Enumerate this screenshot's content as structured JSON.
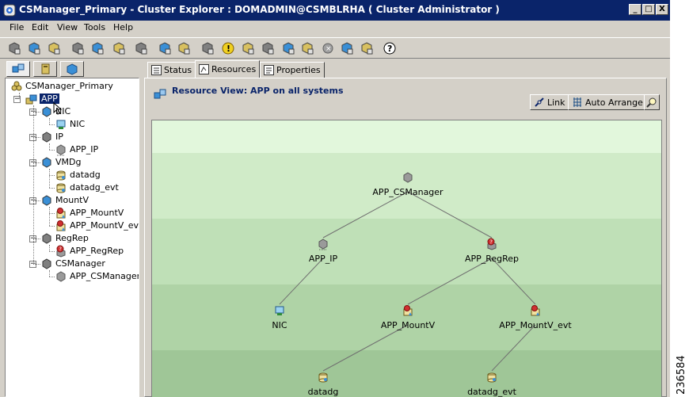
{
  "window": {
    "title": "CSManager_Primary - Cluster Explorer : DOMADMIN@CSMBLRHA ( Cluster Administrator )",
    "buttons": [
      "_",
      "□",
      "X"
    ]
  },
  "menu": [
    "File",
    "Edit",
    "View",
    "Tools",
    "Help"
  ],
  "toolbar_icons": [
    "online-group",
    "offline-group",
    "switch-group",
    "add-service-group",
    "add-resource",
    "link-resource",
    "import-resource",
    "configure-vcs",
    "cluster-shell",
    "virtual-fire-drill",
    "query",
    "show-command-center",
    "show-template-view",
    "config-wizard",
    "remote-group",
    "logs",
    "search",
    "refresh",
    "help"
  ],
  "left_tabs": [
    "service-groups-tab",
    "systems-tab",
    "types-tab"
  ],
  "tree": {
    "root": "CSManager_Primary",
    "group": "APP",
    "types": [
      {
        "name": "NIC",
        "color": "#3a8fd6",
        "children": [
          "NIC"
        ]
      },
      {
        "name": "IP",
        "color": "#808080",
        "children": [
          "APP_IP"
        ]
      },
      {
        "name": "VMDg",
        "color": "#3a8fd6",
        "children": [
          "datadg",
          "datadg_evt"
        ]
      },
      {
        "name": "MountV",
        "color": "#3a8fd6",
        "children": [
          "APP_MountV",
          "APP_MountV_evt"
        ]
      },
      {
        "name": "RegRep",
        "color": "#808080",
        "children": [
          "APP_RegRep"
        ]
      },
      {
        "name": "CSManager",
        "color": "#808080",
        "children": [
          "APP_CSManager"
        ]
      }
    ]
  },
  "right_tabs": [
    "Status",
    "Resources",
    "Properties"
  ],
  "view": {
    "title": "Resource View: APP on all systems",
    "link_label": "Link",
    "auto_arrange_label": "Auto Arrange"
  },
  "graph": {
    "nodes": [
      {
        "id": "APP_CSManager",
        "label": "APP_CSManager",
        "kind": "generic",
        "level": 0,
        "col": 0.5
      },
      {
        "id": "APP_IP",
        "label": "APP_IP",
        "kind": "ip",
        "level": 1,
        "col": 0.335
      },
      {
        "id": "APP_RegRep",
        "label": "APP_RegRep",
        "kind": "regrep",
        "level": 1,
        "col": 0.665
      },
      {
        "id": "NIC",
        "label": "NIC",
        "kind": "nic",
        "level": 2,
        "col": 0.25
      },
      {
        "id": "APP_MountV",
        "label": "APP_MountV",
        "kind": "mountv",
        "level": 2,
        "col": 0.5
      },
      {
        "id": "APP_MountV_evt",
        "label": "APP_MountV_evt",
        "kind": "mountv",
        "level": 2,
        "col": 0.75
      },
      {
        "id": "datadg",
        "label": "datadg",
        "kind": "vmdg",
        "level": 3,
        "col": 0.335
      },
      {
        "id": "datadg_evt",
        "label": "datadg_evt",
        "kind": "vmdg",
        "level": 3,
        "col": 0.665
      }
    ],
    "edges": [
      [
        "APP_CSManager",
        "APP_IP"
      ],
      [
        "APP_CSManager",
        "APP_RegRep"
      ],
      [
        "APP_IP",
        "NIC"
      ],
      [
        "APP_RegRep",
        "APP_MountV"
      ],
      [
        "APP_RegRep",
        "APP_MountV_evt"
      ],
      [
        "APP_MountV",
        "datadg"
      ],
      [
        "APP_MountV_evt",
        "datadg_evt"
      ]
    ]
  },
  "band_colors": [
    "#e2f7dc",
    "#d0ebc8",
    "#bfe0b7",
    "#afd3a6",
    "#9fc697"
  ],
  "side_code": "236584"
}
